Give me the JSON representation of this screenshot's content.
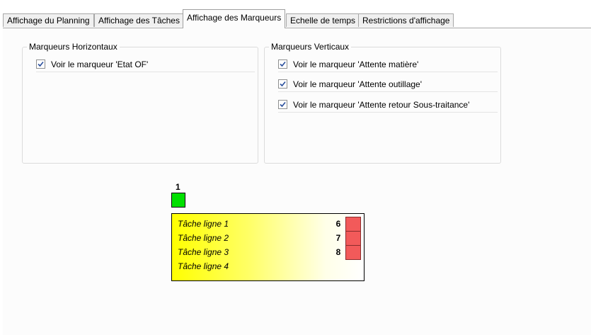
{
  "tabs": [
    {
      "label": "Affichage du Planning",
      "active": false
    },
    {
      "label": "Affichage des Tâches",
      "active": false
    },
    {
      "label": "Affichage des Marqueurs",
      "active": true
    },
    {
      "label": "Echelle de temps",
      "active": false
    },
    {
      "label": "Restrictions d'affichage",
      "active": false
    }
  ],
  "horizontal_group": {
    "title": "Marqueurs Horizontaux",
    "items": [
      {
        "label": "Voir le marqueur 'Etat OF'",
        "checked": true
      }
    ]
  },
  "vertical_group": {
    "title": "Marqueurs Verticaux",
    "items": [
      {
        "label": "Voir le marqueur 'Attente matière'",
        "checked": true
      },
      {
        "label": "Voir le marqueur 'Attente outillage'",
        "checked": true
      },
      {
        "label": "Voir le marqueur 'Attente retour Sous-traitance'",
        "checked": true
      }
    ]
  },
  "preview": {
    "horizontal_marker_number": "1",
    "horizontal_marker_color": "#00e000",
    "task_lines": [
      "Tâche ligne 1",
      "Tâche ligne 2",
      "Tâche ligne 3",
      "Tâche ligne 4"
    ],
    "vertical_marker_numbers": [
      "6",
      "7",
      "8"
    ],
    "vertical_marker_color": "#f25a5a",
    "task_gradient_start": "#ffff00"
  }
}
